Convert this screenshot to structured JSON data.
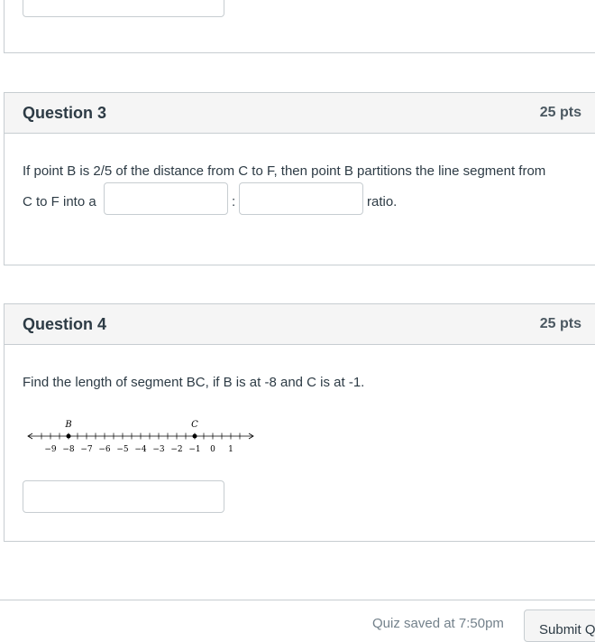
{
  "questions": [
    {
      "title": "Question 3",
      "points": "25 pts",
      "text_line1": "If point B is 2/5 of the distance from C to F, then point B partitions the line segment from",
      "text_prefix": "C to F into a",
      "separator": ":",
      "text_suffix": "ratio."
    },
    {
      "title": "Question 4",
      "points": "25 pts",
      "text": "Find the length of segment BC, if B is at -8 and C is at -1."
    }
  ],
  "number_line": {
    "min": -10,
    "max": 2,
    "tick_labels": [
      "−9",
      "−8",
      "−7",
      "−6",
      "−5",
      "−4",
      "−3",
      "−2",
      "−1",
      "0",
      "1"
    ],
    "points": [
      {
        "label": "B",
        "value": -8
      },
      {
        "label": "C",
        "value": -1
      }
    ]
  },
  "footer": {
    "saved_text": "Quiz saved at 7:50pm",
    "submit_label": "Submit Quiz"
  }
}
